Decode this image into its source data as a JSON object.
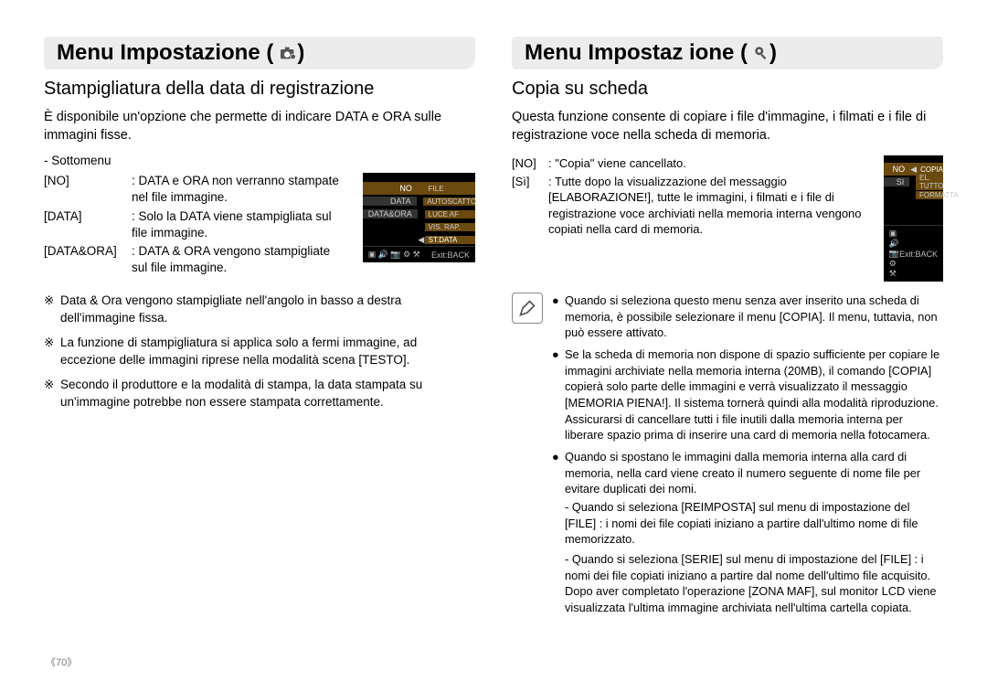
{
  "left": {
    "header_title": "Menu Impostazione (",
    "header_close": ")",
    "section_title": "Stampigliatura della data di registrazione",
    "intro": "È disponibile un'opzione che permette di indicare DATA e ORA sulle immagini fisse.",
    "submenu_label": "- Sottomenu",
    "opts": {
      "no_key": "[NO]",
      "no_val": ": DATA e ORA non verranno stampate nel file immagine.",
      "data_key": "[DATA]",
      "data_val": ": Solo la DATA viene stampigliata sul file immagine.",
      "both_key": "[DATA&ORA]",
      "both_val": ": DATA  & ORA vengono stampigliate sul file immagine."
    },
    "lcd": {
      "r1_left": "NO",
      "r1_right": "FILE",
      "r2_left": "DATA",
      "r2_right": "AUTOSCATTO",
      "r3_left": "DATA&ORA",
      "r3_right": "LUCE AF",
      "r4_left": "",
      "r4_right": "VIS. RAP.",
      "r5_left": "",
      "r5_mid": "◀",
      "r5_right": "ST.DATA",
      "exit": "Exit:BACK"
    },
    "bul1": "Data & Ora vengono stampigliate nell'angolo in basso a destra dell'immagine fissa.",
    "bul2": "La funzione di stampigliatura si applica solo a fermi immagine, ad eccezione delle immagini riprese nella modalità scena [TESTO].",
    "bul3": "Secondo il produttore e la modalità di stampa, la data stampata su un'immagine potrebbe non essere stampata correttamente."
  },
  "right": {
    "header_title": "Menu Impostaz ione (",
    "header_close": ")",
    "section_title": "Copia su scheda",
    "intro": "Questa funzione consente di copiare i file d'immagine, i filmati e i file di registrazione voce nella scheda di memoria.",
    "opts": {
      "no_key": "[NO]",
      "no_val": ": \"Copia\" viene cancellato.",
      "si_key": "[Sì]",
      "si_val": ": Tutte dopo la visualizzazione del messaggio [ELABORAZIONE!], tutte le immagini, i filmati e i file di registrazione voce archiviati nella memoria interna vengono copiati nella card di memoria."
    },
    "lcd": {
      "r1_left": "NO",
      "r1_right": "COPIA",
      "r2_left": "SI",
      "r2_right": "EL. TUTTO",
      "r3_left": "",
      "r3_right": "FORMATTA",
      "exit": "Exit:BACK"
    },
    "note1": "Quando si seleziona questo menu senza aver inserito una scheda di memoria, è possibile selezionare il menu [COPIA]. Il menu, tuttavia, non può essere attivato.",
    "note2": "Se la scheda di memoria non dispone di spazio sufficiente per copiare le immagini archiviate nella memoria interna (20MB), il comando [COPIA] copierà solo parte delle immagini e verrà visualizzato il messaggio [MEMORIA PIENA!]. Il sistema tornerà quindi alla modalità riproduzione. Assicurarsi di cancellare tutti i file inutili dalla memoria interna per liberare spazio prima di inserire una card di memoria nella fotocamera.",
    "note3": "Quando si spostano le immagini dalla memoria interna alla card di memoria, nella card viene creato il numero seguente di nome file per evitare duplicati dei nomi.",
    "sub1": "- Quando si seleziona [REIMPOSTA] sul menu di impostazione del [FILE] : i nomi dei file copiati iniziano a partire dall'ultimo nome di file memorizzato.",
    "sub2": "- Quando si seleziona [SERIE]  sul menu di impostazione del [FILE] : i nomi dei file copiati iniziano a partire dal nome dell'ultimo file acquisito. Dopo aver completato l'operazione [ZONA MAF], sul monitor LCD viene visualizzata l'ultima immagine archiviata nell'ultima cartella copiata."
  },
  "page_number": "《70》"
}
